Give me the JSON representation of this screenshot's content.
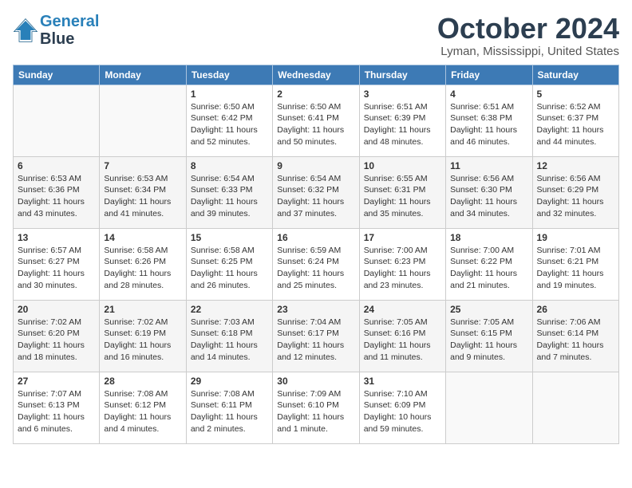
{
  "header": {
    "logo_line1": "General",
    "logo_line2": "Blue",
    "month_title": "October 2024",
    "location": "Lyman, Mississippi, United States"
  },
  "weekdays": [
    "Sunday",
    "Monday",
    "Tuesday",
    "Wednesday",
    "Thursday",
    "Friday",
    "Saturday"
  ],
  "weeks": [
    [
      {
        "day": "",
        "info": ""
      },
      {
        "day": "",
        "info": ""
      },
      {
        "day": "1",
        "info": "Sunrise: 6:50 AM\nSunset: 6:42 PM\nDaylight: 11 hours and 52 minutes."
      },
      {
        "day": "2",
        "info": "Sunrise: 6:50 AM\nSunset: 6:41 PM\nDaylight: 11 hours and 50 minutes."
      },
      {
        "day": "3",
        "info": "Sunrise: 6:51 AM\nSunset: 6:39 PM\nDaylight: 11 hours and 48 minutes."
      },
      {
        "day": "4",
        "info": "Sunrise: 6:51 AM\nSunset: 6:38 PM\nDaylight: 11 hours and 46 minutes."
      },
      {
        "day": "5",
        "info": "Sunrise: 6:52 AM\nSunset: 6:37 PM\nDaylight: 11 hours and 44 minutes."
      }
    ],
    [
      {
        "day": "6",
        "info": "Sunrise: 6:53 AM\nSunset: 6:36 PM\nDaylight: 11 hours and 43 minutes."
      },
      {
        "day": "7",
        "info": "Sunrise: 6:53 AM\nSunset: 6:34 PM\nDaylight: 11 hours and 41 minutes."
      },
      {
        "day": "8",
        "info": "Sunrise: 6:54 AM\nSunset: 6:33 PM\nDaylight: 11 hours and 39 minutes."
      },
      {
        "day": "9",
        "info": "Sunrise: 6:54 AM\nSunset: 6:32 PM\nDaylight: 11 hours and 37 minutes."
      },
      {
        "day": "10",
        "info": "Sunrise: 6:55 AM\nSunset: 6:31 PM\nDaylight: 11 hours and 35 minutes."
      },
      {
        "day": "11",
        "info": "Sunrise: 6:56 AM\nSunset: 6:30 PM\nDaylight: 11 hours and 34 minutes."
      },
      {
        "day": "12",
        "info": "Sunrise: 6:56 AM\nSunset: 6:29 PM\nDaylight: 11 hours and 32 minutes."
      }
    ],
    [
      {
        "day": "13",
        "info": "Sunrise: 6:57 AM\nSunset: 6:27 PM\nDaylight: 11 hours and 30 minutes."
      },
      {
        "day": "14",
        "info": "Sunrise: 6:58 AM\nSunset: 6:26 PM\nDaylight: 11 hours and 28 minutes."
      },
      {
        "day": "15",
        "info": "Sunrise: 6:58 AM\nSunset: 6:25 PM\nDaylight: 11 hours and 26 minutes."
      },
      {
        "day": "16",
        "info": "Sunrise: 6:59 AM\nSunset: 6:24 PM\nDaylight: 11 hours and 25 minutes."
      },
      {
        "day": "17",
        "info": "Sunrise: 7:00 AM\nSunset: 6:23 PM\nDaylight: 11 hours and 23 minutes."
      },
      {
        "day": "18",
        "info": "Sunrise: 7:00 AM\nSunset: 6:22 PM\nDaylight: 11 hours and 21 minutes."
      },
      {
        "day": "19",
        "info": "Sunrise: 7:01 AM\nSunset: 6:21 PM\nDaylight: 11 hours and 19 minutes."
      }
    ],
    [
      {
        "day": "20",
        "info": "Sunrise: 7:02 AM\nSunset: 6:20 PM\nDaylight: 11 hours and 18 minutes."
      },
      {
        "day": "21",
        "info": "Sunrise: 7:02 AM\nSunset: 6:19 PM\nDaylight: 11 hours and 16 minutes."
      },
      {
        "day": "22",
        "info": "Sunrise: 7:03 AM\nSunset: 6:18 PM\nDaylight: 11 hours and 14 minutes."
      },
      {
        "day": "23",
        "info": "Sunrise: 7:04 AM\nSunset: 6:17 PM\nDaylight: 11 hours and 12 minutes."
      },
      {
        "day": "24",
        "info": "Sunrise: 7:05 AM\nSunset: 6:16 PM\nDaylight: 11 hours and 11 minutes."
      },
      {
        "day": "25",
        "info": "Sunrise: 7:05 AM\nSunset: 6:15 PM\nDaylight: 11 hours and 9 minutes."
      },
      {
        "day": "26",
        "info": "Sunrise: 7:06 AM\nSunset: 6:14 PM\nDaylight: 11 hours and 7 minutes."
      }
    ],
    [
      {
        "day": "27",
        "info": "Sunrise: 7:07 AM\nSunset: 6:13 PM\nDaylight: 11 hours and 6 minutes."
      },
      {
        "day": "28",
        "info": "Sunrise: 7:08 AM\nSunset: 6:12 PM\nDaylight: 11 hours and 4 minutes."
      },
      {
        "day": "29",
        "info": "Sunrise: 7:08 AM\nSunset: 6:11 PM\nDaylight: 11 hours and 2 minutes."
      },
      {
        "day": "30",
        "info": "Sunrise: 7:09 AM\nSunset: 6:10 PM\nDaylight: 11 hours and 1 minute."
      },
      {
        "day": "31",
        "info": "Sunrise: 7:10 AM\nSunset: 6:09 PM\nDaylight: 10 hours and 59 minutes."
      },
      {
        "day": "",
        "info": ""
      },
      {
        "day": "",
        "info": ""
      }
    ]
  ]
}
